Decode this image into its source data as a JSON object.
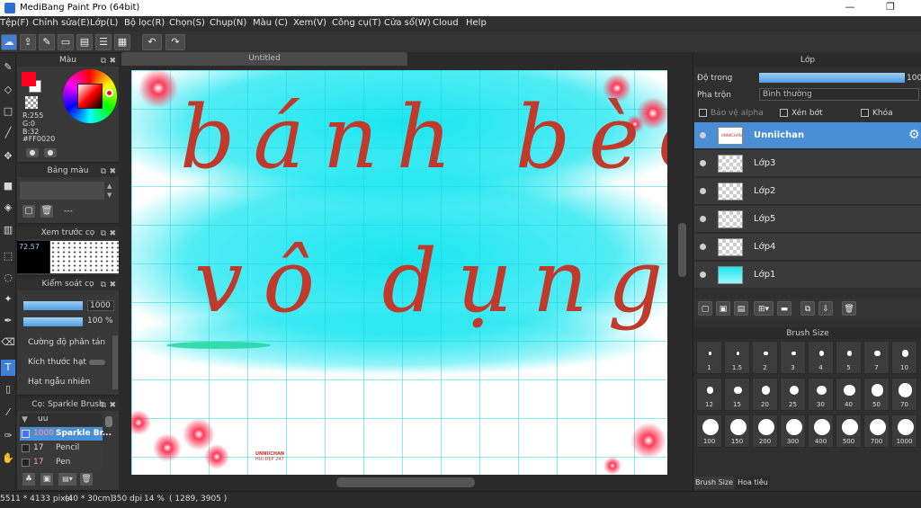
{
  "window": {
    "title": "MediBang Paint Pro (64bit)",
    "minimize": "—",
    "restore": "❐"
  },
  "menu": [
    "Tệp(F)",
    "Chỉnh sửa(E)",
    "Lớp(L)",
    "Bộ lọc(R)",
    "Chọn(S)",
    "Chụp(N)",
    "Màu (C)",
    "Xem(V)",
    "Công cụ(T)",
    "Cửa sổ(W)",
    "Cloud",
    "Help"
  ],
  "toolbar": {
    "undo": "↶",
    "redo": "↷"
  },
  "color_panel": {
    "title": "Màu",
    "r": "R:255",
    "g": "G:0",
    "b": "B:32",
    "hex": "#FF0020",
    "primary": "#ff0020",
    "secondary": "#ffffff"
  },
  "palette_panel": {
    "title": "Bảng màu",
    "value": "---"
  },
  "brush_preview_panel": {
    "title": "Xem trước cọ",
    "size": "72.57"
  },
  "brush_control_panel": {
    "title": "Kiểm soát cọ",
    "size_value": "1000",
    "opacity_value": "100 %",
    "options": [
      "Cường độ phân tán",
      "Kích thước hạt",
      "Hạt ngẫu nhiên"
    ]
  },
  "brush_list_panel": {
    "title": "Cọ: Sparkle Brush",
    "group": "uu",
    "items": [
      {
        "size": "1000",
        "name": "Sparkle Br..."
      },
      {
        "size": "17",
        "name": "Pencil"
      },
      {
        "size": "17",
        "name": "Pen"
      }
    ]
  },
  "document": {
    "tab": "Untitled",
    "lines": [
      "bánh bèo",
      "vô dụng"
    ],
    "watermark_1": "UNNIICHAN",
    "watermark_2": "HUI ĐẸP 247",
    "ink_color": "#c0392b",
    "bg_color": "#19e6f0"
  },
  "layer_panel": {
    "title": "Lớp",
    "opacity_label": "Độ trong",
    "opacity_value": "100",
    "opacity_fraction": 1.0,
    "blend_label": "Pha trộn",
    "blend_value": "Bình thường",
    "protect_alpha": "Bảo vệ alpha",
    "clip": "Xén bớt",
    "lock": "Khóa",
    "layers": [
      {
        "name": "Unniichan",
        "selected": true
      },
      {
        "name": "Lớp3"
      },
      {
        "name": "Lớp2"
      },
      {
        "name": "Lớp5"
      },
      {
        "name": "Lớp4"
      },
      {
        "name": "Lớp1"
      }
    ]
  },
  "brush_size_panel": {
    "title": "Brush Size",
    "sizes": [
      "1",
      "1.5",
      "2",
      "3",
      "4",
      "5",
      "7",
      "10",
      "12",
      "15",
      "20",
      "25",
      "30",
      "40",
      "50",
      "70",
      "100",
      "150",
      "200",
      "300",
      "400",
      "500",
      "700",
      "1000"
    ],
    "tabs": [
      "Brush Size",
      "Hoa tiêu"
    ]
  },
  "status": {
    "image_size": "5511 * 4133 pixel",
    "physical": "(40 * 30cm)",
    "dpi": "350 dpi",
    "zoom": "14 %",
    "coords": "( 1289, 3905 )"
  }
}
